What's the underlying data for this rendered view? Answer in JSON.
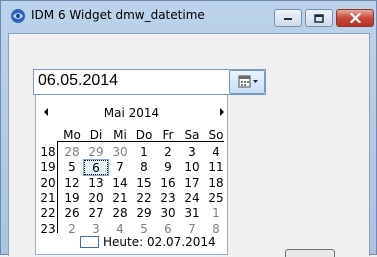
{
  "window": {
    "title": "IDM 6 Widget dmw_datetime"
  },
  "date_field": {
    "value": "06.05.2014"
  },
  "calendar": {
    "month_label": "Mai 2014",
    "weekday_headers": [
      "Mo",
      "Di",
      "Mi",
      "Do",
      "Fr",
      "Sa",
      "So"
    ],
    "weeks": [
      {
        "week": "18",
        "days": [
          {
            "d": "28",
            "muted": true
          },
          {
            "d": "29",
            "muted": true
          },
          {
            "d": "30",
            "muted": true
          },
          {
            "d": "1"
          },
          {
            "d": "2"
          },
          {
            "d": "3"
          },
          {
            "d": "4"
          }
        ]
      },
      {
        "week": "19",
        "days": [
          {
            "d": "5"
          },
          {
            "d": "6",
            "selected": true
          },
          {
            "d": "7"
          },
          {
            "d": "8"
          },
          {
            "d": "9"
          },
          {
            "d": "10"
          },
          {
            "d": "11"
          }
        ]
      },
      {
        "week": "20",
        "days": [
          {
            "d": "12"
          },
          {
            "d": "13"
          },
          {
            "d": "14"
          },
          {
            "d": "15"
          },
          {
            "d": "16"
          },
          {
            "d": "17"
          },
          {
            "d": "18"
          }
        ]
      },
      {
        "week": "21",
        "days": [
          {
            "d": "19"
          },
          {
            "d": "20"
          },
          {
            "d": "21"
          },
          {
            "d": "22"
          },
          {
            "d": "23"
          },
          {
            "d": "24"
          },
          {
            "d": "25"
          }
        ]
      },
      {
        "week": "22",
        "days": [
          {
            "d": "26"
          },
          {
            "d": "27"
          },
          {
            "d": "28"
          },
          {
            "d": "29"
          },
          {
            "d": "30"
          },
          {
            "d": "31"
          },
          {
            "d": "1",
            "muted": true
          }
        ]
      },
      {
        "week": "23",
        "days": [
          {
            "d": "2",
            "muted": true
          },
          {
            "d": "3",
            "muted": true
          },
          {
            "d": "4",
            "muted": true
          },
          {
            "d": "5",
            "muted": true
          },
          {
            "d": "6",
            "muted": true
          },
          {
            "d": "7",
            "muted": true
          },
          {
            "d": "8",
            "muted": true
          }
        ]
      }
    ],
    "today_label": "Heute: 02.07.2014"
  },
  "colors": {
    "muted_day": "#808080",
    "selection_outline": "#7aa7d6"
  }
}
